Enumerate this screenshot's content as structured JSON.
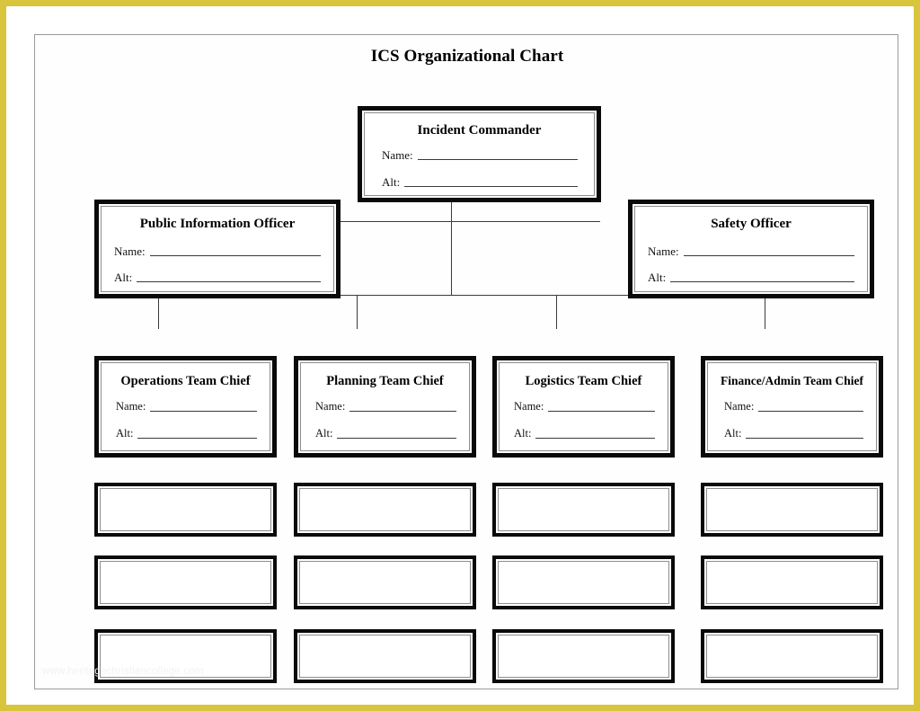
{
  "document": {
    "title": "ICS Organizational Chart",
    "watermark": "www.heritagechristiancollege.com",
    "frame_color": "#d8c53c",
    "page_border_color": "#9a9a9a",
    "box_border_color": "#0a0a0a",
    "connector_color": "#3b3b3b"
  },
  "fields": {
    "name_label": "Name:",
    "alt_label": "Alt:"
  },
  "chart_data": {
    "type": "diagram",
    "title": "ICS Organizational Chart",
    "layout": "org-chart",
    "levels": [
      {
        "level": 1,
        "nodes": [
          {
            "id": "incident-commander",
            "title": "Incident Commander",
            "fields": [
              "Name:",
              "Alt:"
            ]
          }
        ]
      },
      {
        "level": 2,
        "nodes": [
          {
            "id": "public-information-officer",
            "title": "Public Information Officer",
            "fields": [
              "Name:",
              "Alt:"
            ]
          },
          {
            "id": "safety-officer",
            "title": "Safety Officer",
            "fields": [
              "Name:",
              "Alt:"
            ]
          }
        ]
      },
      {
        "level": 3,
        "nodes": [
          {
            "id": "operations-team-chief",
            "title": "Operations Team Chief",
            "fields": [
              "Name:",
              "Alt:"
            ]
          },
          {
            "id": "planning-team-chief",
            "title": "Planning Team Chief",
            "fields": [
              "Name:",
              "Alt:"
            ]
          },
          {
            "id": "logistics-team-chief",
            "title": "Logistics Team Chief",
            "fields": [
              "Name:",
              "Alt:"
            ]
          },
          {
            "id": "finance-admin-team-chief",
            "title": "Finance/Admin Team Chief",
            "fields": [
              "Name:",
              "Alt:"
            ]
          }
        ]
      },
      {
        "level": 4,
        "nodes": [
          {
            "id": "blank-r1c1",
            "title": ""
          },
          {
            "id": "blank-r1c2",
            "title": ""
          },
          {
            "id": "blank-r1c3",
            "title": ""
          },
          {
            "id": "blank-r1c4",
            "title": ""
          }
        ]
      },
      {
        "level": 5,
        "nodes": [
          {
            "id": "blank-r2c1",
            "title": ""
          },
          {
            "id": "blank-r2c2",
            "title": ""
          },
          {
            "id": "blank-r2c3",
            "title": ""
          },
          {
            "id": "blank-r2c4",
            "title": ""
          }
        ]
      },
      {
        "level": 6,
        "nodes": [
          {
            "id": "blank-r3c1",
            "title": ""
          },
          {
            "id": "blank-r3c2",
            "title": ""
          },
          {
            "id": "blank-r3c3",
            "title": ""
          },
          {
            "id": "blank-r3c4",
            "title": ""
          }
        ]
      }
    ],
    "edges": [
      {
        "from": "incident-commander",
        "to": "public-information-officer"
      },
      {
        "from": "incident-commander",
        "to": "safety-officer"
      },
      {
        "from": "incident-commander",
        "to": "operations-team-chief"
      },
      {
        "from": "incident-commander",
        "to": "planning-team-chief"
      },
      {
        "from": "incident-commander",
        "to": "logistics-team-chief"
      },
      {
        "from": "incident-commander",
        "to": "finance-admin-team-chief"
      },
      {
        "from": "operations-team-chief",
        "to": "blank-r1c1"
      },
      {
        "from": "planning-team-chief",
        "to": "blank-r1c2"
      },
      {
        "from": "logistics-team-chief",
        "to": "blank-r1c3"
      },
      {
        "from": "finance-admin-team-chief",
        "to": "blank-r1c4"
      },
      {
        "from": "blank-r1c1",
        "to": "blank-r2c1"
      },
      {
        "from": "blank-r1c2",
        "to": "blank-r2c2"
      },
      {
        "from": "blank-r1c3",
        "to": "blank-r2c3"
      },
      {
        "from": "blank-r1c4",
        "to": "blank-r2c4"
      },
      {
        "from": "blank-r2c1",
        "to": "blank-r3c1"
      },
      {
        "from": "blank-r2c2",
        "to": "blank-r3c2"
      },
      {
        "from": "blank-r2c3",
        "to": "blank-r3c3"
      },
      {
        "from": "blank-r2c4",
        "to": "blank-r3c4"
      }
    ]
  },
  "boxes": {
    "incident_commander": {
      "title": "Incident Commander"
    },
    "public_information_officer": {
      "title": "Public Information Officer"
    },
    "safety_officer": {
      "title": "Safety Officer"
    },
    "operations_team_chief": {
      "title": "Operations Team Chief"
    },
    "planning_team_chief": {
      "title": "Planning Team Chief"
    },
    "logistics_team_chief": {
      "title": "Logistics Team Chief"
    },
    "finance_admin_team_chief": {
      "title": "Finance/Admin Team Chief"
    }
  }
}
